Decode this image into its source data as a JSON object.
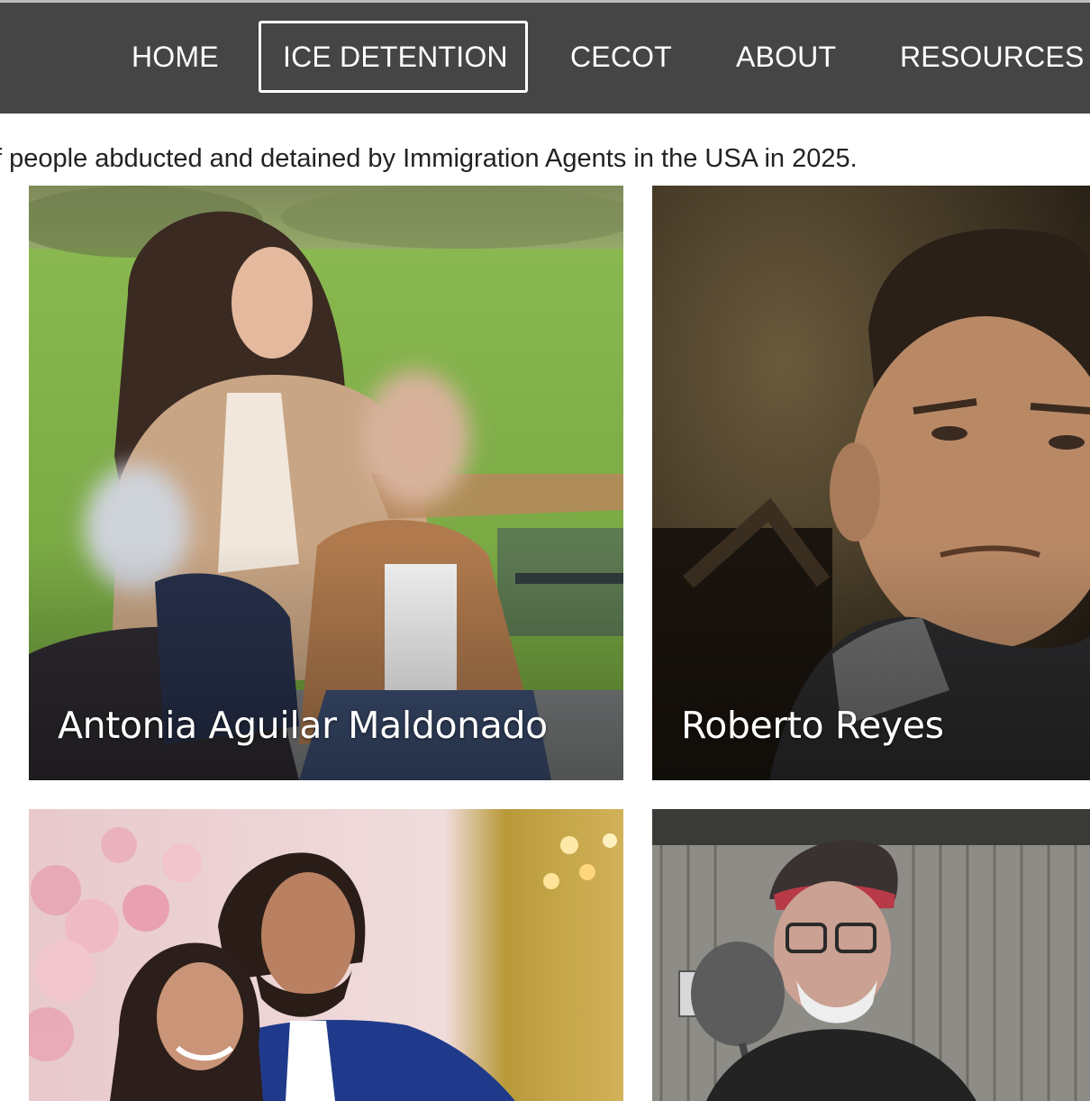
{
  "nav": {
    "items": [
      {
        "label": "HOME"
      },
      {
        "label": "ICE DETENTION",
        "active": true
      },
      {
        "label": "CECOT"
      },
      {
        "label": "ABOUT"
      },
      {
        "label": "RESOURCES"
      }
    ]
  },
  "intro": {
    "text": "f people abducted and detained by Immigration Agents in the USA in 2025."
  },
  "cards": [
    {
      "name": "Antonia Aguilar Maldonado"
    },
    {
      "name": "Roberto Reyes"
    },
    {
      "name": ""
    },
    {
      "name": ""
    }
  ],
  "colors": {
    "nav_bg": "#454545",
    "nav_text": "#ffffff",
    "body_text": "#222222"
  }
}
